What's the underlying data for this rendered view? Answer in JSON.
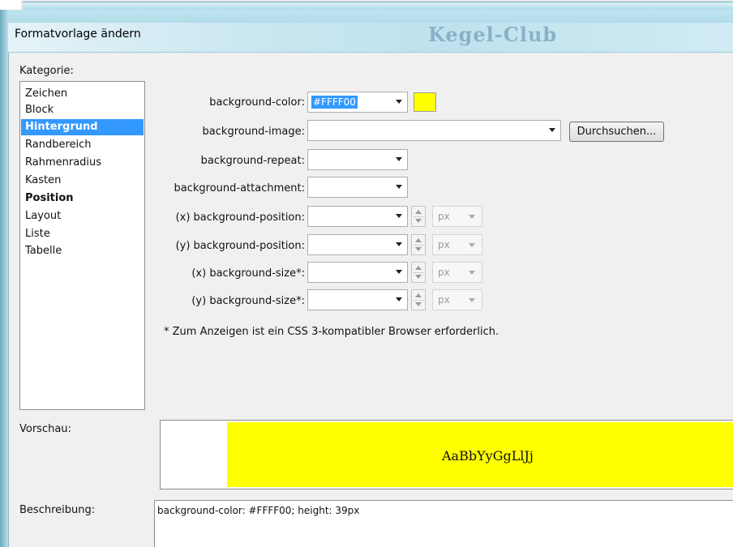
{
  "dialog": {
    "title": "Formatvorlage ändern",
    "brand": "Kegel-Club"
  },
  "category": {
    "label": "Kategorie:",
    "items": [
      {
        "label": "Zeichen"
      },
      {
        "label": "Block"
      },
      {
        "label": "Hintergrund",
        "selected": true
      },
      {
        "label": "Randbereich"
      },
      {
        "label": "Rahmenradius"
      },
      {
        "label": "Kasten"
      },
      {
        "label": "Position",
        "bold": true
      },
      {
        "label": "Layout"
      },
      {
        "label": "Liste"
      },
      {
        "label": "Tabelle"
      }
    ]
  },
  "fields": {
    "bg_color": {
      "label": "background-color:",
      "value": "#FFFF00",
      "swatch": "#FFFF00"
    },
    "bg_image": {
      "label": "background-image:",
      "value": "",
      "browse": "Durchsuchen..."
    },
    "bg_repeat": {
      "label": "background-repeat:",
      "value": ""
    },
    "bg_attachment": {
      "label": "background-attachment:",
      "value": ""
    },
    "pos_x": {
      "label": "(x) background-position:",
      "unit": "px"
    },
    "pos_y": {
      "label": "(y) background-position:",
      "unit": "px"
    },
    "size_x": {
      "label": "(x) background-size*:",
      "unit": "px"
    },
    "size_y": {
      "label": "(y) background-size*:",
      "unit": "px"
    }
  },
  "note": "* Zum Anzeigen ist ein CSS 3-kompatibler Browser erforderlich.",
  "preview": {
    "label": "Vorschau:",
    "sample": "AaBbYyGgLlJj",
    "bg_color": "#FFFF00"
  },
  "description": {
    "label": "Beschreibung:",
    "text": "background-color: #FFFF00; height: 39px"
  }
}
